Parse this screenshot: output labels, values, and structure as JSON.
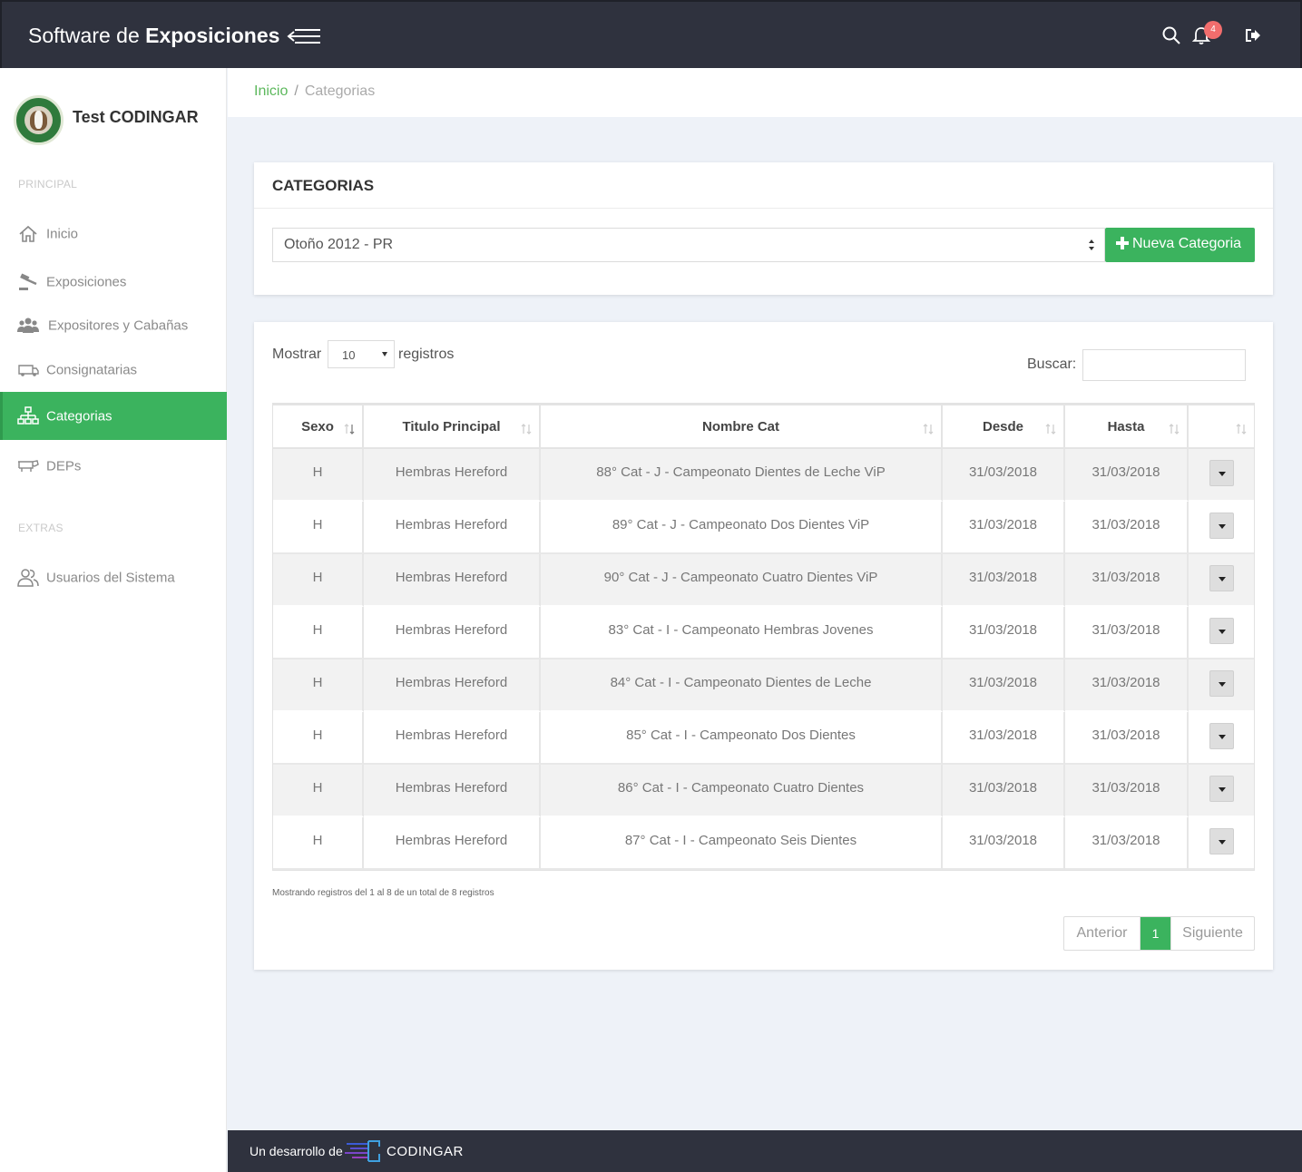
{
  "app": {
    "brand_light": "Software de",
    "brand_bold": "Exposiciones",
    "notification_count": "4"
  },
  "sidebar": {
    "user_name": "Test CODINGAR",
    "section_principal": "PRINCIPAL",
    "section_extras": "EXTRAS",
    "items": [
      {
        "label": "Inicio",
        "icon": "home-icon"
      },
      {
        "label": "Exposiciones",
        "icon": "gavel-icon"
      },
      {
        "label": "Expositores y Cabañas",
        "icon": "users-icon"
      },
      {
        "label": "Consignatarias",
        "icon": "truck-icon"
      },
      {
        "label": "Categorias",
        "icon": "sitemap-icon",
        "active": true
      },
      {
        "label": "DEPs",
        "icon": "cow-icon"
      },
      {
        "label": "Usuarios del Sistema",
        "icon": "user-group-icon"
      }
    ]
  },
  "breadcrumb": {
    "home": "Inicio",
    "separator": "/",
    "current": "Categorias"
  },
  "categories_card": {
    "title": "CATEGORIAS",
    "selected_exposition": "Otoño 2012 - PR",
    "new_button": "Nueva Categoria"
  },
  "table_controls": {
    "show_label": "Mostrar",
    "page_length": "10",
    "records_label": "registros",
    "search_label": "Buscar:",
    "search_value": ""
  },
  "table": {
    "columns": [
      "Sexo",
      "Titulo Principal",
      "Nombre Cat",
      "Desde",
      "Hasta",
      ""
    ],
    "rows": [
      [
        "H",
        "Hembras Hereford",
        "88° Cat - J - Campeonato Dientes de Leche ViP",
        "31/03/2018",
        "31/03/2018"
      ],
      [
        "H",
        "Hembras Hereford",
        "89° Cat - J - Campeonato Dos Dientes ViP",
        "31/03/2018",
        "31/03/2018"
      ],
      [
        "H",
        "Hembras Hereford",
        "90° Cat - J - Campeonato Cuatro Dientes ViP",
        "31/03/2018",
        "31/03/2018"
      ],
      [
        "H",
        "Hembras Hereford",
        "83° Cat - I - Campeonato Hembras Jovenes",
        "31/03/2018",
        "31/03/2018"
      ],
      [
        "H",
        "Hembras Hereford",
        "84° Cat - I - Campeonato Dientes de Leche",
        "31/03/2018",
        "31/03/2018"
      ],
      [
        "H",
        "Hembras Hereford",
        "85° Cat - I - Campeonato Dos Dientes",
        "31/03/2018",
        "31/03/2018"
      ],
      [
        "H",
        "Hembras Hereford",
        "86° Cat - I - Campeonato Cuatro Dientes",
        "31/03/2018",
        "31/03/2018"
      ],
      [
        "H",
        "Hembras Hereford",
        "87° Cat - I - Campeonato Seis Dientes",
        "31/03/2018",
        "31/03/2018"
      ]
    ],
    "info": "Mostrando registros del 1 al 8 de un total de 8 registros"
  },
  "pagination": {
    "prev": "Anterior",
    "current_page": "1",
    "next": "Siguiente"
  },
  "footer": {
    "text": "Un desarrollo de",
    "brand": "CODINGAR"
  },
  "colors": {
    "topbar": "#2f323e",
    "accent_green": "#3bb35e",
    "badge_red": "#f26d6d",
    "background": "#eef2f8"
  }
}
